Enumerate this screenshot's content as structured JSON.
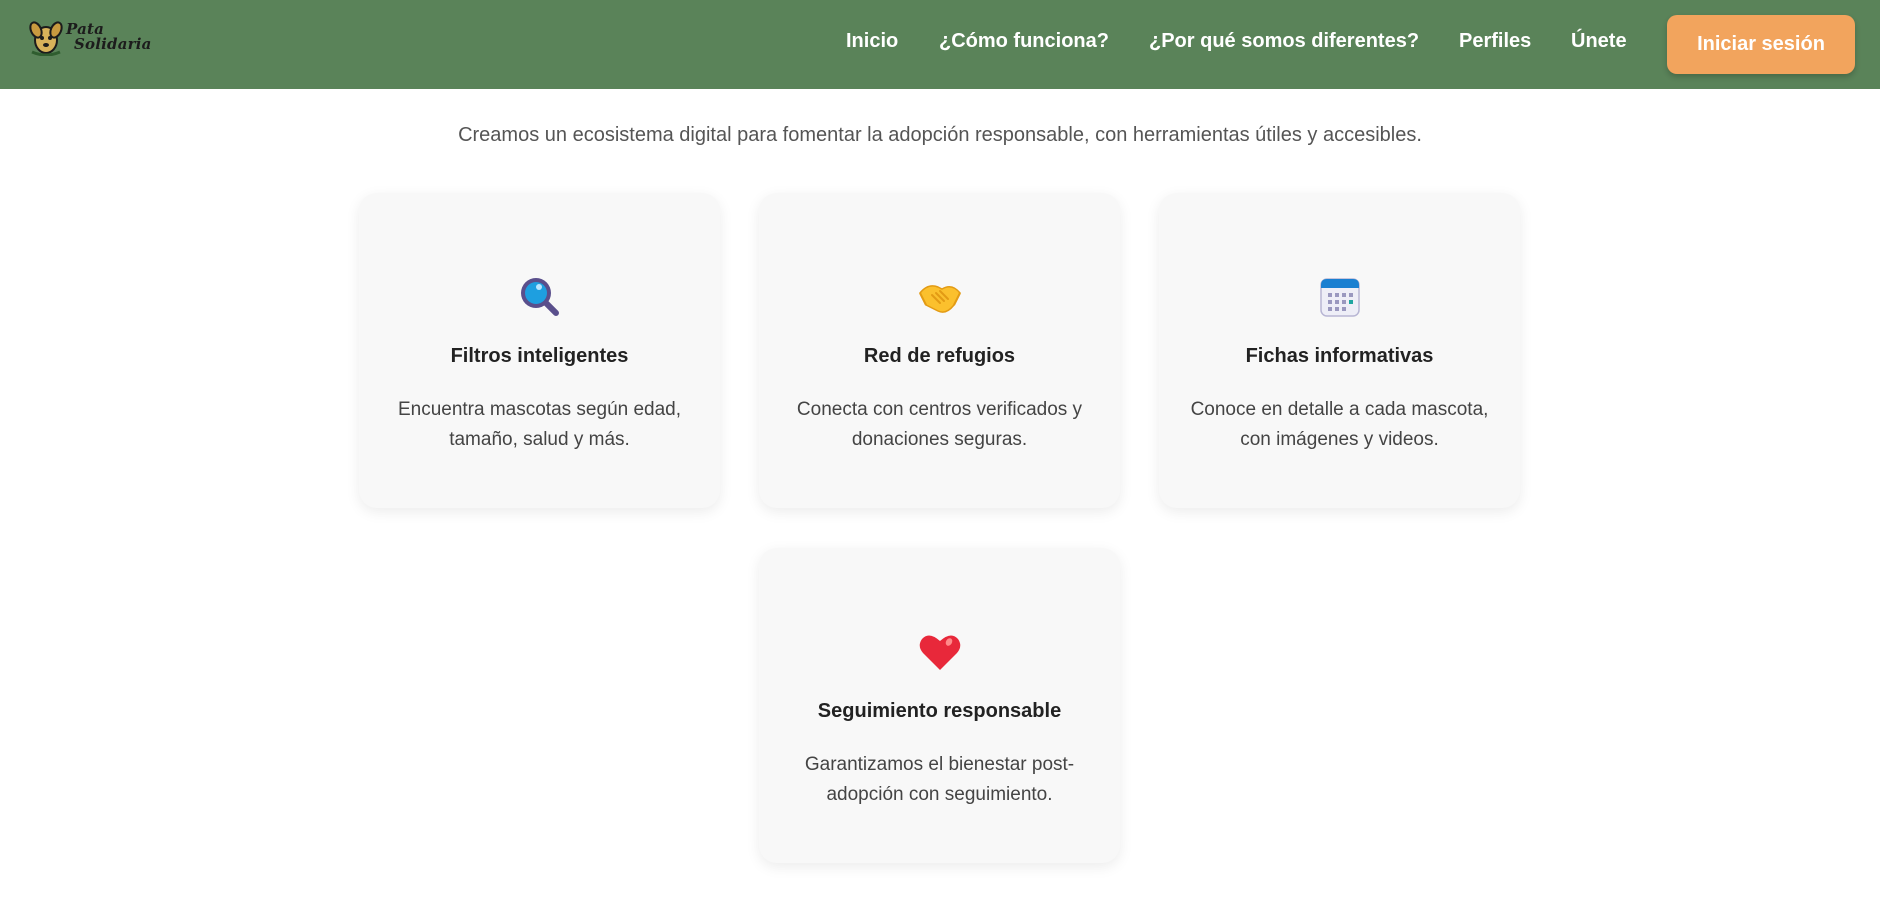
{
  "brand": {
    "line1": "Pata",
    "line2": "Solidaria"
  },
  "nav": {
    "items": [
      {
        "label": "Inicio"
      },
      {
        "label": "¿Cómo funciona?"
      },
      {
        "label": "¿Por qué somos diferentes?"
      },
      {
        "label": "Perfiles"
      },
      {
        "label": "Únete"
      }
    ],
    "login_label": "Iniciar sesión"
  },
  "intro": {
    "text": "Creamos un ecosistema digital para fomentar la adopción responsable, con herramientas útiles y accesibles."
  },
  "features": [
    {
      "icon": "magnifying-glass-icon",
      "title": "Filtros inteligentes",
      "description": "Encuentra mascotas según edad, tamaño, salud y más."
    },
    {
      "icon": "handshake-icon",
      "title": "Red de refugios",
      "description": "Conecta con centros verificados y donaciones seguras."
    },
    {
      "icon": "calendar-icon",
      "title": "Fichas informativas",
      "description": "Conoce en detalle a cada mascota, con imágenes y videos."
    },
    {
      "icon": "heart-icon",
      "title": "Seguimiento responsable",
      "description": "Garantizamos el bienestar post-adopción con seguimiento."
    }
  ],
  "colors": {
    "navbar": "#5a8359",
    "accent": "#f2a45d",
    "card": "#f8f8f8"
  }
}
